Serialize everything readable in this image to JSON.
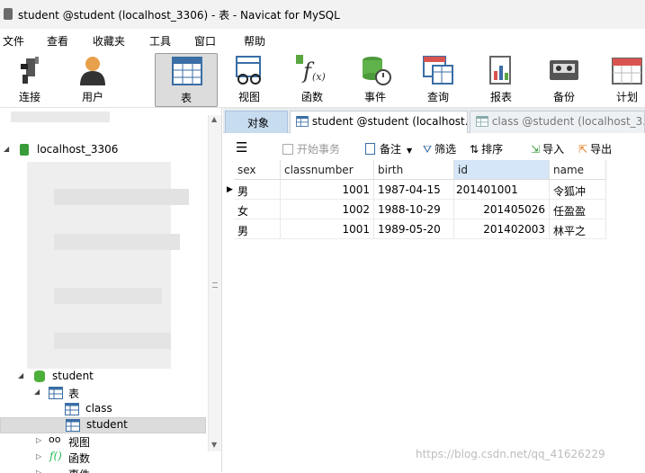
{
  "window": {
    "title": "student @student (localhost_3306) - 表 - Navicat for MySQL"
  },
  "menu": [
    "文件",
    "查看",
    "收藏夹",
    "工具",
    "窗口",
    "帮助"
  ],
  "toolbar": [
    {
      "label": "连接",
      "icon": "plug-icon"
    },
    {
      "label": "用户",
      "icon": "user-icon"
    },
    {
      "label": "表",
      "icon": "table-icon"
    },
    {
      "label": "视图",
      "icon": "view-icon"
    },
    {
      "label": "函数",
      "icon": "function-icon"
    },
    {
      "label": "事件",
      "icon": "event-icon"
    },
    {
      "label": "查询",
      "icon": "query-icon"
    },
    {
      "label": "报表",
      "icon": "report-icon"
    },
    {
      "label": "备份",
      "icon": "backup-icon"
    },
    {
      "label": "计划",
      "icon": "calendar-icon"
    }
  ],
  "tree": {
    "connection": "localhost_3306",
    "database": "student",
    "tables_group": "表",
    "tables": [
      "class",
      "student"
    ],
    "views_group": "视图",
    "functions_group": "函数",
    "events_group": "事件"
  },
  "tabs": [
    "对象",
    "student @student (localhost...",
    "class @student (localhost_3..."
  ],
  "subtoolbar": {
    "begin_transaction": "开始事务",
    "note": "备注",
    "filter": "筛选",
    "sort": "排序",
    "import": "导入",
    "export": "导出"
  },
  "grid": {
    "columns": [
      "sex",
      "classnumber",
      "birth",
      "id",
      "name"
    ],
    "rows": [
      [
        "男",
        "1001",
        "1987-04-15",
        "201401001",
        "令狐冲"
      ],
      [
        "女",
        "1002",
        "1988-10-29",
        "201405026",
        "任盈盈"
      ],
      [
        "男",
        "1001",
        "1989-05-20",
        "201402003",
        "林平之"
      ]
    ]
  },
  "watermark": "https://blog.csdn.net/qq_41626229"
}
